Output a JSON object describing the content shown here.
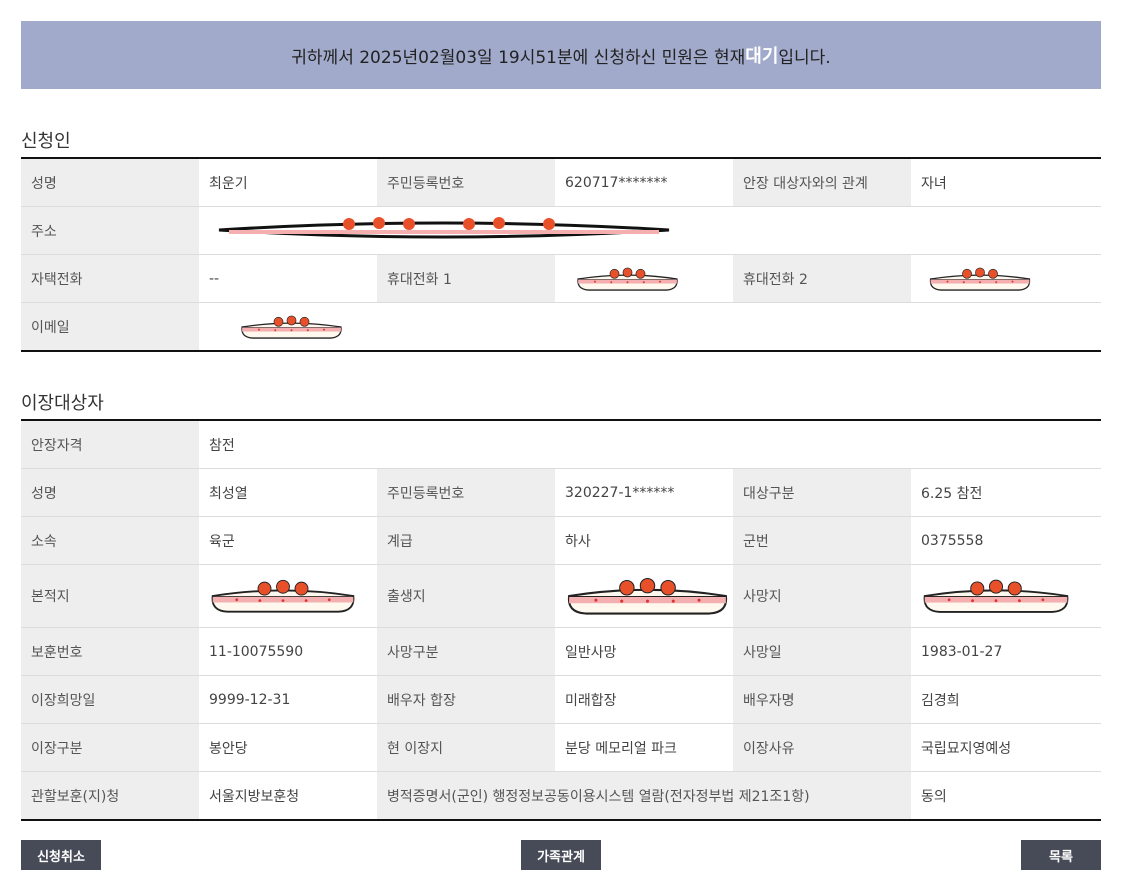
{
  "banner": {
    "prefix": "귀하께서 2025년02월03일 19시51분에 신청하신 민원은 현재 ",
    "status": "대기",
    "suffix": "입니다."
  },
  "applicant": {
    "title": "신청인",
    "name_label": "성명",
    "name": "최운기",
    "rrn_label": "주민등록번호",
    "rrn": "620717*******",
    "relation_label": "안장 대상자와의 관계",
    "relation": "자녀",
    "address_label": "주소",
    "home_phone_label": "자택전화",
    "home_phone": "--",
    "mobile1_label": "휴대전화 1",
    "mobile2_label": "휴대전화 2",
    "email_label": "이메일"
  },
  "target": {
    "title": "이장대상자",
    "qualification_label": "안장자격",
    "qualification": "참전",
    "name_label": "성명",
    "name": "최성열",
    "rrn_label": "주민등록번호",
    "rrn": "320227-1******",
    "category_label": "대상구분",
    "category": "6.25 참전",
    "unit_label": "소속",
    "unit": "육군",
    "rank_label": "계급",
    "rank": "하사",
    "service_no_label": "군번",
    "service_no": "0375558",
    "domicile_label": "본적지",
    "birthplace_label": "출생지",
    "death_place_label": "사망지",
    "veteran_no_label": "보훈번호",
    "veteran_no": "11-10075590",
    "death_type_label": "사망구분",
    "death_type": "일반사망",
    "death_date_label": "사망일",
    "death_date": "1983-01-27",
    "desired_date_label": "이장희망일",
    "desired_date": "9999-12-31",
    "spouse_burial_label": "배우자 합장",
    "spouse_burial": "미래합장",
    "spouse_name_label": "배우자명",
    "spouse_name": "김경희",
    "relocation_type_label": "이장구분",
    "relocation_type": "봉안당",
    "current_site_label": "현 이장지",
    "current_site": "분당 메모리얼 파크",
    "reason_label": "이장사유",
    "reason": "국립묘지영예성",
    "office_label": "관할보훈(지)청",
    "office": "서울지방보훈청",
    "consent_label": "병적증명서(군인) 행정정보공동이용시스템 열람(전자정부법 제21조1항)",
    "consent": "동의"
  },
  "buttons": {
    "cancel": "신청취소",
    "family": "가족관계",
    "list": "목록"
  },
  "colors": {
    "banner_bg": "#a1aacb",
    "label_bg": "#eeeeee",
    "button_bg": "#474b57",
    "redaction_cake": "#e8502a"
  }
}
